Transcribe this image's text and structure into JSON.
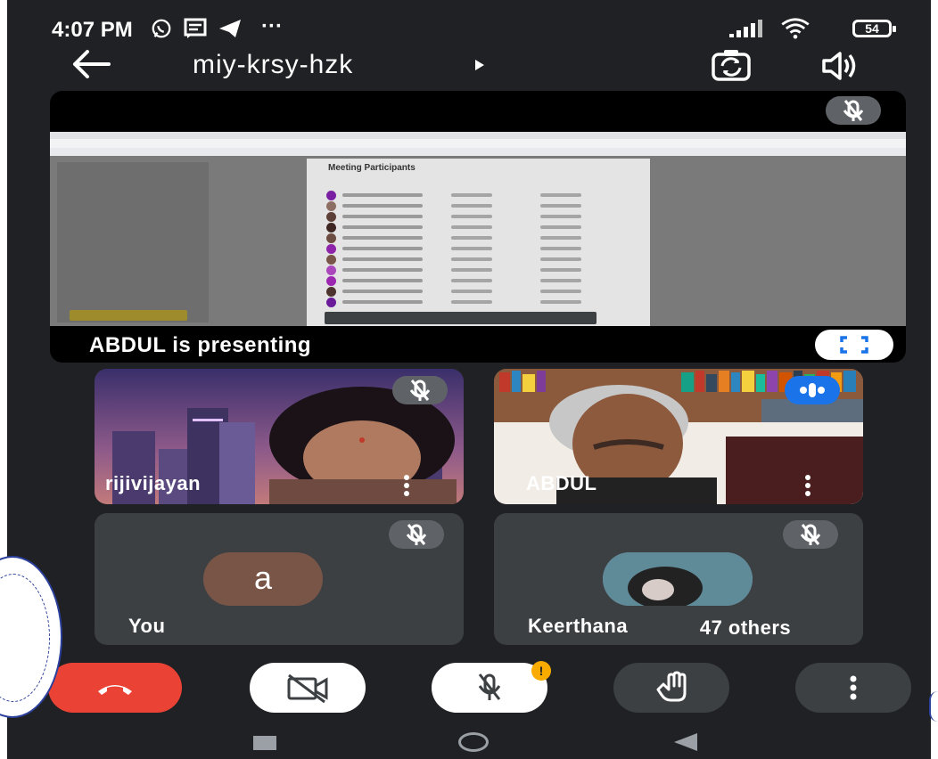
{
  "status_bar": {
    "time": "4:07 PM",
    "icons": [
      "whatsapp-icon",
      "message-icon",
      "telegram-icon",
      "more-notifications-icon",
      "signal-icon",
      "wifi-icon",
      "battery-icon"
    ],
    "more_indicator": "···",
    "battery": "54"
  },
  "header": {
    "meeting_code": "miy-krsy-hzk",
    "caret": "▸"
  },
  "presentation": {
    "label": "ABDUL is presenting",
    "dialog_title": "Meeting Participants"
  },
  "tiles": [
    {
      "name": "rijivijayan"
    },
    {
      "name": "ABDUL"
    },
    {
      "name": "You",
      "avatar_letter": "a"
    },
    {
      "name": "Keerthana",
      "others": "47 others"
    }
  ],
  "controls": {
    "mic_warning": "!"
  },
  "colors": {
    "background": "#202124",
    "tile": "#3c4043",
    "end_call": "#ea4335",
    "warning": "#f9ab00",
    "avatar_you": "#795548"
  }
}
